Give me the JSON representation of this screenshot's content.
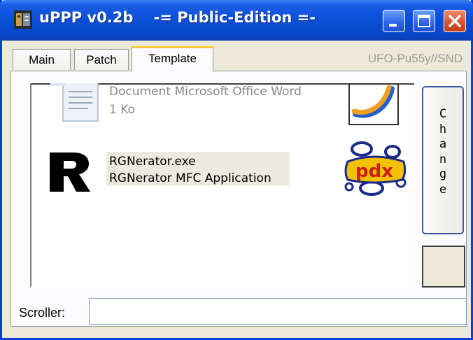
{
  "window": {
    "title": "uPPP v0.2b",
    "edition": "-= Public-Edition =-",
    "icon": "app-icon"
  },
  "tabs": [
    {
      "label": "Main",
      "active": false
    },
    {
      "label": "Patch",
      "active": false
    },
    {
      "label": "Template",
      "active": true
    }
  ],
  "credit": "UFO-Pu55y//SND",
  "template": {
    "items": [
      {
        "name": "Document Microsoft Office Word",
        "detail": "1 Ko",
        "icon": "word-document-icon",
        "right_icon": "swirl-logo-icon"
      },
      {
        "name": "RGNerator.exe",
        "detail": "RGNerator MFC Application",
        "icon": "r-letter-icon",
        "right_icon": "pdx-logo-icon"
      }
    ],
    "change_button": "C\nh\na\nn\ng\ne",
    "logo_text": "pdx"
  },
  "scroller": {
    "label": "Scroller:",
    "value": ""
  },
  "colors": {
    "titlebar": "#0b4fd6",
    "close_button": "#d9502a",
    "active_tab_accent": "#ffc73c",
    "window_bg": "#ece9d8"
  }
}
